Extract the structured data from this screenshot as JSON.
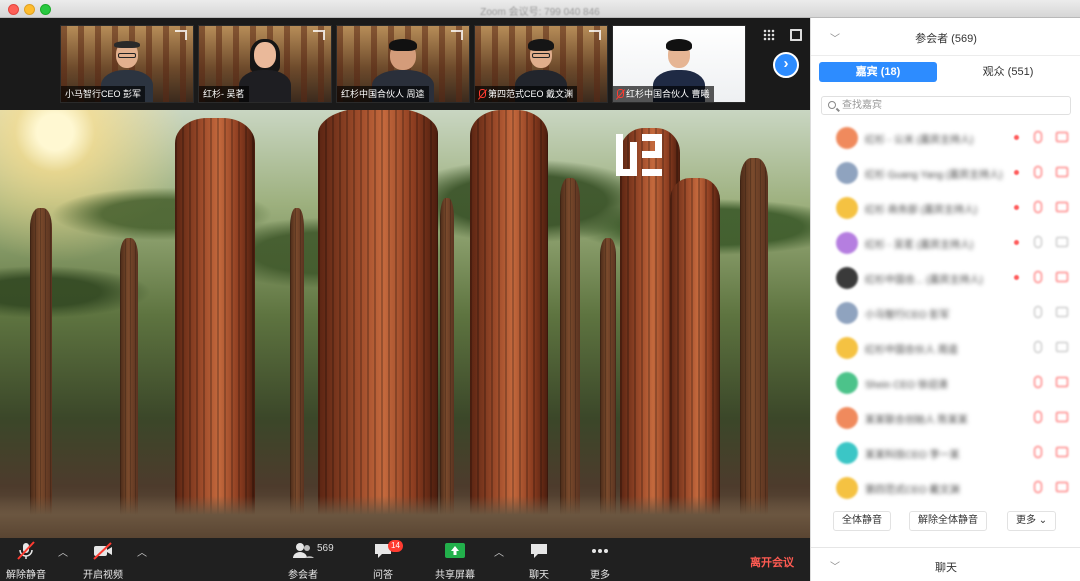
{
  "window": {
    "title": "Zoom 会议号: 799 040 846"
  },
  "gallery": {
    "tiles": [
      {
        "label": "小马智行CEO 彭军",
        "muted": false
      },
      {
        "label": "红杉- 吴茗",
        "muted": false
      },
      {
        "label": "红杉中国合伙人 周逵",
        "muted": false
      },
      {
        "label": "第四范式CEO 戴文渊",
        "muted": true
      },
      {
        "label": "红杉中国合伙人 曹曦",
        "muted": true
      }
    ],
    "next_icon": "chevron-right-icon"
  },
  "toolbar": {
    "unmute_label": "解除静音",
    "start_video_label": "开启视频",
    "participants_label": "参会者",
    "participants_count": "569",
    "qa_label": "问答",
    "qa_badge": "14",
    "share_label": "共享屏幕",
    "chat_label": "聊天",
    "more_label": "更多",
    "leave_label": "离开会议",
    "leave_color": "#ff5b52",
    "share_color": "#22b04b"
  },
  "panel": {
    "title": "参会者 (569)",
    "tab_panelists": "嘉宾 (18)",
    "tab_attendees": "观众 (551)",
    "search_placeholder": "查找嘉宾",
    "mute_all": "全体静音",
    "unmute_all": "解除全体静音",
    "more": "更多",
    "chat_title": "聊天",
    "accent": "#2d8cff",
    "participants": [
      {
        "name": "红杉 - 公关 (嘉宾主持人)",
        "avatar_color": "#f08a5d",
        "mic_muted": true,
        "cam_off": true,
        "dot": true
      },
      {
        "name": "红杉 Guang Yang (嘉宾主持人)",
        "avatar_color": "#8fa3bf",
        "mic_muted": true,
        "cam_off": true,
        "dot": true
      },
      {
        "name": "红杉 商务部 (嘉宾主持人)",
        "avatar_color": "#f5c242",
        "mic_muted": true,
        "cam_off": true,
        "dot": true
      },
      {
        "name": "红杉 - 吴茗 (嘉宾主持人)",
        "avatar_color": "#b57ee0",
        "mic_muted": false,
        "cam_off": false,
        "dot": true
      },
      {
        "name": "红杉中国合... (嘉宾主持人)",
        "avatar_color": "#3a3a3a",
        "mic_muted": true,
        "cam_off": true,
        "dot": true
      },
      {
        "name": "小马智行CEO 彭军",
        "avatar_color": "#8fa3bf",
        "mic_muted": false,
        "cam_off": false,
        "dot": false
      },
      {
        "name": "红杉中国合伙人 周逵",
        "avatar_color": "#f5c242",
        "mic_muted": false,
        "cam_off": false,
        "dot": false
      },
      {
        "name": "Shein CEO 徐迎清",
        "avatar_color": "#4cc38a",
        "mic_muted": true,
        "cam_off": true,
        "dot": false
      },
      {
        "name": "某某联合创始人 陈某某",
        "avatar_color": "#f08a5d",
        "mic_muted": true,
        "cam_off": true,
        "dot": false
      },
      {
        "name": "某某科技CEO 李一某",
        "avatar_color": "#3bc6c6",
        "mic_muted": true,
        "cam_off": true,
        "dot": false
      },
      {
        "name": "第四范式CEO 戴文渊",
        "avatar_color": "#f5c242",
        "mic_muted": true,
        "cam_off": true,
        "dot": false
      }
    ]
  }
}
